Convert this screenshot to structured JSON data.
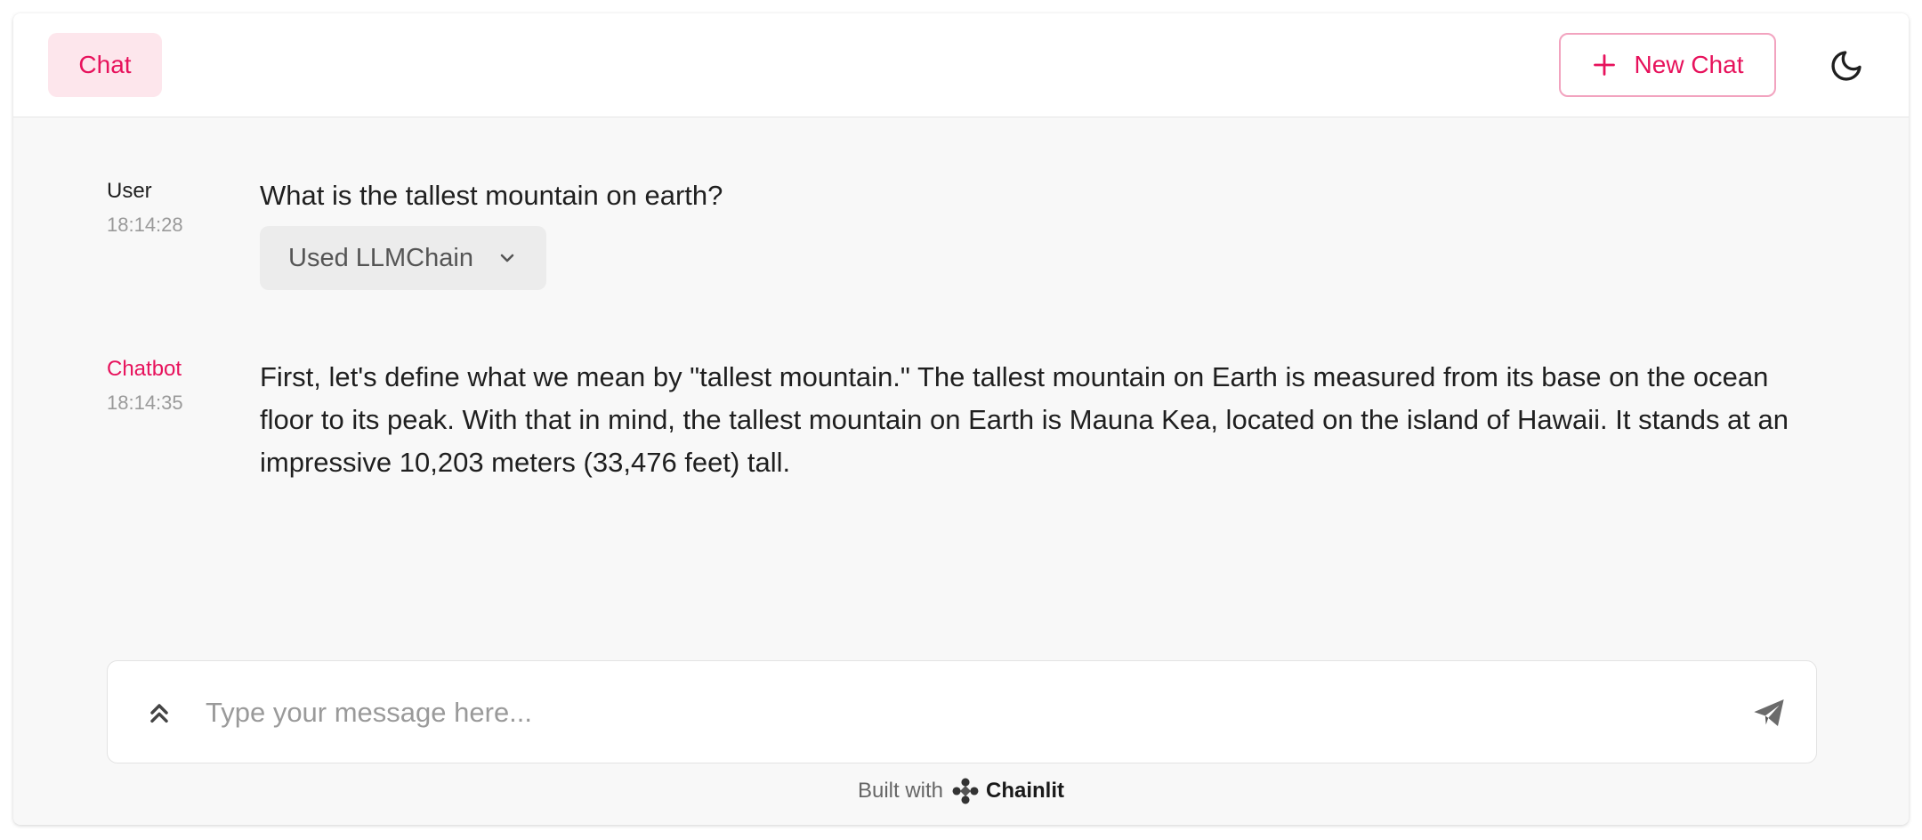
{
  "header": {
    "tab_label": "Chat",
    "new_chat_label": "New Chat"
  },
  "messages": [
    {
      "author": "User",
      "time": "18:14:28",
      "text": "What is the tallest mountain on earth?",
      "step_label": "Used LLMChain"
    },
    {
      "author": "Chatbot",
      "time": "18:14:35",
      "text": "First, let's define what we mean by \"tallest mountain.\" The tallest mountain on Earth is measured from its base on the ocean floor to its peak. With that in mind, the tallest mountain on Earth is Mauna Kea, located on the island of Hawaii. It stands at an impressive 10,203 meters (33,476 feet) tall."
    }
  ],
  "composer": {
    "placeholder": "Type your message here..."
  },
  "footer": {
    "built_with": "Built with",
    "brand": "Chainlit"
  },
  "colors": {
    "accent": "#e7125c",
    "accent_bg": "#fde6ec",
    "page_bg": "#f8f8f8"
  },
  "icons": {
    "new_chat": "plus-icon",
    "theme": "moon-icon",
    "step": "chevron-down-icon",
    "expand": "chevrons-up-icon",
    "send": "send-icon",
    "brand": "chainlit-logo-icon"
  }
}
